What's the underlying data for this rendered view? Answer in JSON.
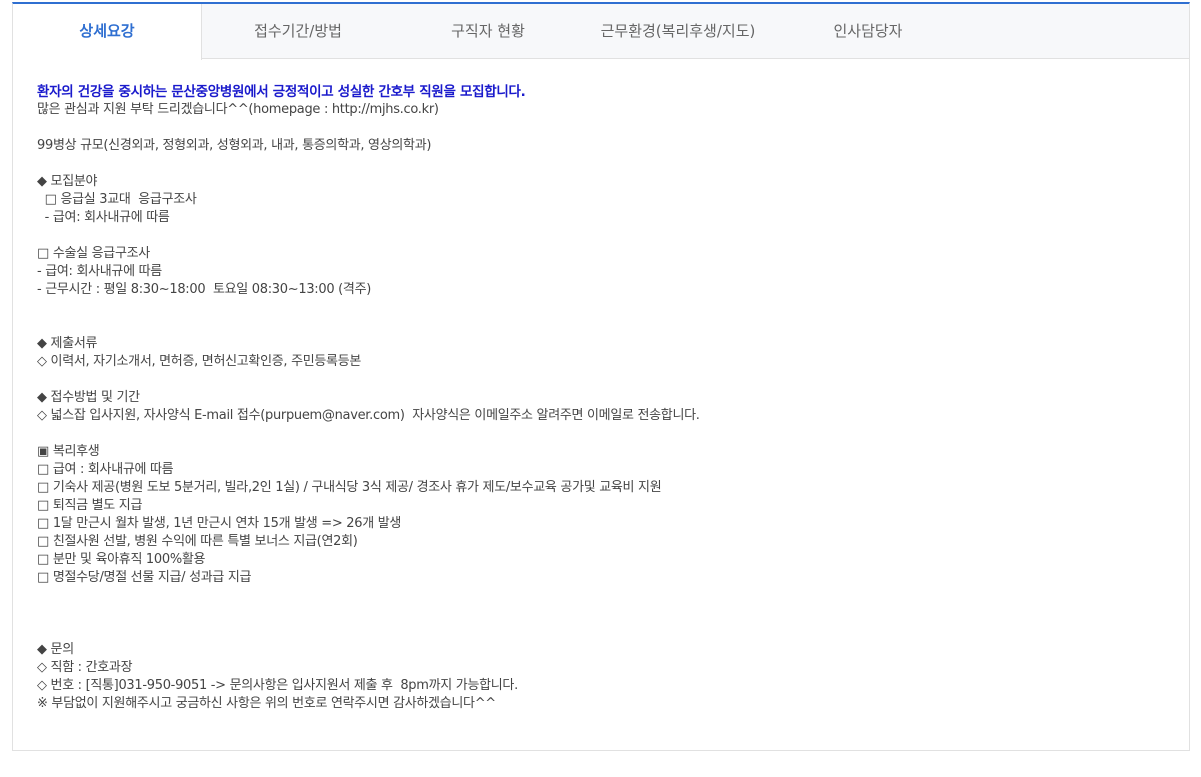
{
  "tabs": [
    {
      "label": "상세요강",
      "active": true
    },
    {
      "label": "접수기간/방법",
      "active": false
    },
    {
      "label": "구직자 현황",
      "active": false
    },
    {
      "label": "근무환경(복리후생/지도)",
      "active": false
    },
    {
      "label": "인사담당자",
      "active": false
    }
  ],
  "content": {
    "headline": "환자의 건강을 중시하는 문산중앙병원에서 긍정적이고 성실한 간호부 직원을 모집합니다.",
    "intro": "많은 관심과 지원 부탁 드리겠습니다^^(homepage : http://mjhs.co.kr)",
    "scale": "99병상 규모(신경외과, 정형외과, 성형외과, 내과, 통증의학과, 영상의학과)",
    "recruit": {
      "heading": "◆ 모집분야",
      "item1": "  □ 응급실 3교대  응급구조사",
      "item1_salary": "  - 급여: 회사내규에 따름",
      "item2": "□ 수술실 응급구조사",
      "item2_salary": "- 급여: 회사내규에 따름",
      "item2_hours": "- 근무시간 : 평일 8:30~18:00  토요일 08:30~13:00 (격주)"
    },
    "documents": {
      "heading": "◆ 제출서류",
      "list": "◇ 이력서, 자기소개서, 면허증, 면허신고확인증, 주민등록등본"
    },
    "apply": {
      "heading": "◆ 접수방법 및 기간",
      "method": "◇ 넓스잡 입사지원, 자사양식 E-mail 접수(purpuem@naver.com)  자사양식은 이메일주소 알려주면 이메일로 전송합니다."
    },
    "benefits": {
      "heading": "▣ 복리후생",
      "items": [
        "□ 급여 : 회사내규에 따름",
        "□ 기숙사 제공(병원 도보 5분거리, 빌라,2인 1실) / 구내식당 3식 제공/ 경조사 휴가 제도/보수교육 공가및 교육비 지원",
        "□ 퇴직금 별도 지급",
        "□ 1달 만근시 월차 발생, 1년 만근시 연차 15개 발생 => 26개 발생",
        "□ 친절사원 선발, 병원 수익에 따른 특별 보너스 지급(연2회)",
        "□ 분만 및 육아휴직 100%활용",
        "□ 명절수당/명절 선물 지급/ 성과급 지급"
      ]
    },
    "contact": {
      "heading": "◆ 문의",
      "position": "◇ 직함 : 간호과장",
      "phone": "◇ 번호 : [직통]031-950-9051 -> 문의사항은 입사지원서 제출 후  8pm까지 가능합니다.",
      "note": "※ 부담없이 지원해주시고 궁금하신 사항은 위의 번호로 연락주시면 감사하겠습니다^^"
    }
  }
}
